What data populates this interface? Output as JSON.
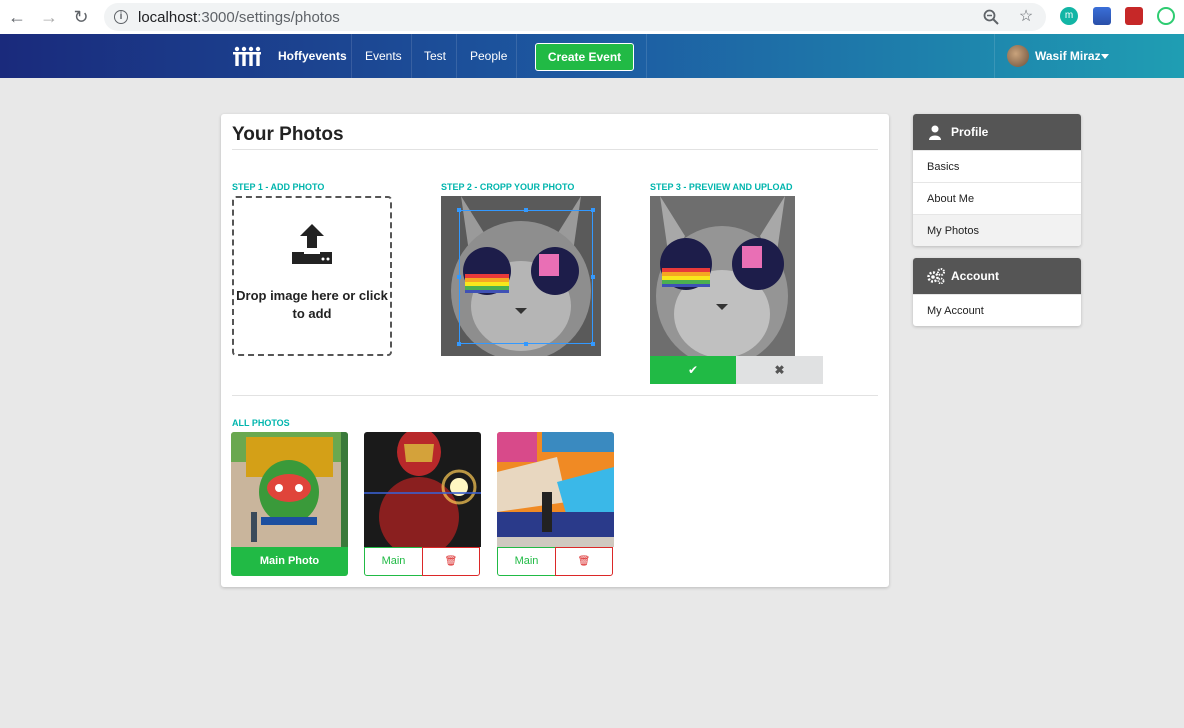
{
  "browser": {
    "url_host": "localhost",
    "url_path": ":3000/settings/photos",
    "ext_m_letter": "m"
  },
  "navbar": {
    "brand": "Hoffyevents",
    "links": [
      "Events",
      "Test",
      "People"
    ],
    "create_button": "Create Event",
    "user_name": "Wasif Miraz"
  },
  "photos_page": {
    "title": "Your Photos",
    "step1_label": "STEP 1 - ADD PHOTO",
    "step2_label": "STEP 2 - CROPP YOUR PHOTO",
    "step3_label": "STEP 3 - PREVIEW AND UPLOAD",
    "dropzone_text": "Drop image here or click to add",
    "confirm_icon": "✔",
    "cancel_icon": "✖",
    "all_photos_label": "ALL PHOTOS",
    "main_photo_button": "Main Photo",
    "main_button": "Main",
    "trash_icon": "🗑"
  },
  "sidebar": {
    "profile_header": "Profile",
    "profile_items": [
      "Basics",
      "About Me",
      "My Photos"
    ],
    "account_header": "Account",
    "account_items": [
      "My Account"
    ]
  },
  "colors": {
    "brand_green": "#21ba45",
    "teal_label": "#00b5ad",
    "delete_red": "#db2828",
    "menu_header": "#555555"
  }
}
